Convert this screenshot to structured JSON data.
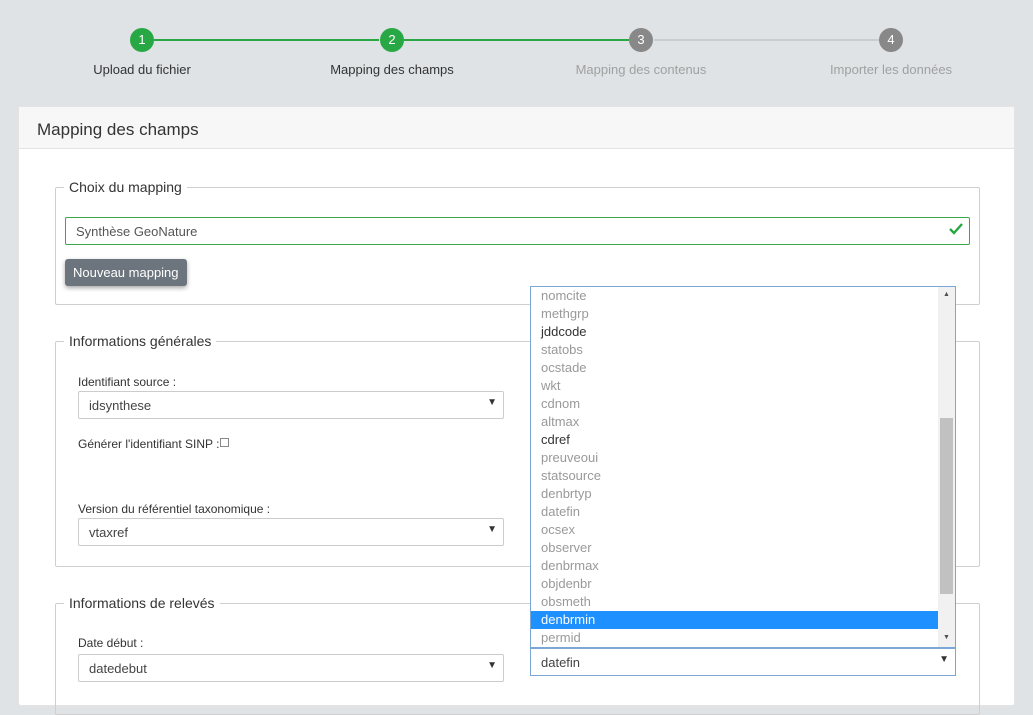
{
  "stepper": {
    "steps": [
      {
        "number": "1",
        "label": "Upload du fichier",
        "state": "done"
      },
      {
        "number": "2",
        "label": "Mapping des champs",
        "state": "active"
      },
      {
        "number": "3",
        "label": "Mapping des contenus",
        "state": "pending"
      },
      {
        "number": "4",
        "label": "Importer les données",
        "state": "pending"
      }
    ],
    "colors": {
      "done": "#28a745",
      "pending": "#888888",
      "label_pending": "#a0a0a0",
      "line_done": "#28a745",
      "line_pending": "#cccccc"
    }
  },
  "card": {
    "title": "Mapping des champs"
  },
  "mapping_choice": {
    "legend": "Choix du mapping",
    "selected": "Synthèse GeoNature",
    "valid_icon": "check-icon",
    "new_button": "Nouveau mapping"
  },
  "general_info": {
    "legend": "Informations générales",
    "source_id_label": "Identifiant source :",
    "source_id_value": "idsynthese",
    "sinp_label": "Générer l'identifiant SINP :",
    "sinp_checked": false,
    "taxref_label": "Version du référentiel taxonomique :",
    "taxref_value": "vtaxref"
  },
  "releves_info": {
    "legend": "Informations de relevés",
    "date_debut_label": "Date début :",
    "date_debut_value": "datedebut",
    "date_fin_value": "datefin"
  },
  "dropdown": {
    "options": [
      {
        "label": "nomcite",
        "enabled": false
      },
      {
        "label": "methgrp",
        "enabled": false
      },
      {
        "label": "jddcode",
        "enabled": true
      },
      {
        "label": "statobs",
        "enabled": false
      },
      {
        "label": "ocstade",
        "enabled": false
      },
      {
        "label": "wkt",
        "enabled": false
      },
      {
        "label": "cdnom",
        "enabled": false
      },
      {
        "label": "altmax",
        "enabled": false
      },
      {
        "label": "cdref",
        "enabled": true
      },
      {
        "label": "preuveoui",
        "enabled": false
      },
      {
        "label": "statsource",
        "enabled": false
      },
      {
        "label": "denbrtyp",
        "enabled": false
      },
      {
        "label": "datefin",
        "enabled": false
      },
      {
        "label": "ocsex",
        "enabled": false
      },
      {
        "label": "observer",
        "enabled": false
      },
      {
        "label": "denbrmax",
        "enabled": false
      },
      {
        "label": "objdenbr",
        "enabled": false
      },
      {
        "label": "obsmeth",
        "enabled": false
      },
      {
        "label": "denbrmin",
        "enabled": true,
        "highlighted": true
      },
      {
        "label": "permid",
        "enabled": false
      },
      {
        "label": "",
        "enabled": false,
        "partial": true
      }
    ],
    "highlight_color": "#1e90ff"
  }
}
